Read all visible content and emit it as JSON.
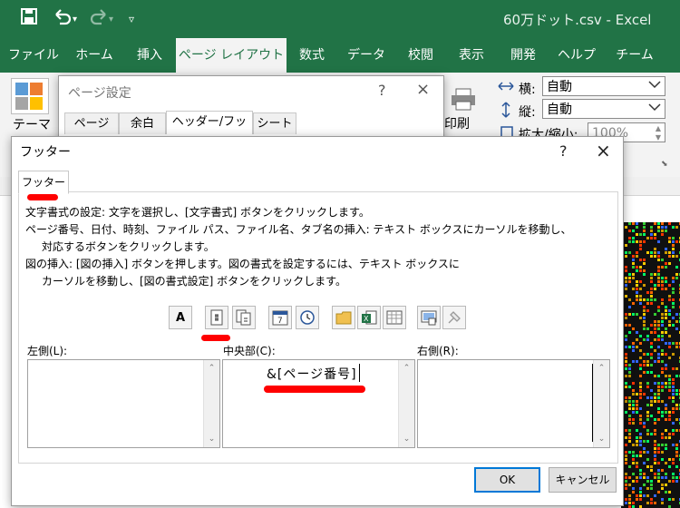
{
  "window": {
    "title": "60万ドット.csv  -  Excel"
  },
  "ribbon": {
    "tabs": [
      "ファイル",
      "ホーム",
      "挿入",
      "ページ レイアウト",
      "数式",
      "データ",
      "校閲",
      "表示",
      "開発",
      "ヘルプ",
      "チーム"
    ],
    "active_tab": "ページ レイアウト",
    "theme_label": "テーマ",
    "print_label": "印刷",
    "width_label": "横:",
    "width_value": "自動",
    "height_label": "縦:",
    "height_value": "自動",
    "scale_label": "拡大/縮小:",
    "scale_value": "100%"
  },
  "page_setup": {
    "title": "ページ設定",
    "help": "?",
    "close": "×",
    "tabs": [
      "ページ",
      "余白",
      "ヘッダー/フッター",
      "シート"
    ]
  },
  "footer_dialog": {
    "title": "フッター",
    "help": "?",
    "close": "×",
    "tab": "フッター",
    "instructions": [
      "文字書式の設定: 文字を選択し、[文字書式] ボタンをクリックします。",
      "ページ番号、日付、時刻、ファイル パス、ファイル名、タブ名の挿入: テキスト ボックスにカーソルを移動し、",
      "対応するボタンをクリックします。",
      "図の挿入: [図の挿入] ボタンを押します。図の書式を設定するには、テキスト ボックスに",
      "カーソルを移動し、[図の書式設定] ボタンをクリックします。"
    ],
    "left_label": "左側(L):",
    "center_label": "中央部(C):",
    "right_label": "右側(R):",
    "left_value": "",
    "center_value": "&[ページ番号]",
    "right_value": "",
    "ok": "OK",
    "cancel": "キャンセル",
    "toolbar_icons": [
      "format-text-icon",
      "insert-page-number-icon",
      "insert-page-count-icon",
      "insert-date-icon",
      "insert-time-icon",
      "insert-file-path-icon",
      "insert-file-name-icon",
      "insert-sheet-name-icon",
      "insert-picture-icon",
      "format-picture-icon"
    ],
    "glyph_A": "A"
  },
  "colors": {
    "excel_green": "#217346",
    "annotation_red": "#ff0000",
    "focus_blue": "#0078d7"
  }
}
